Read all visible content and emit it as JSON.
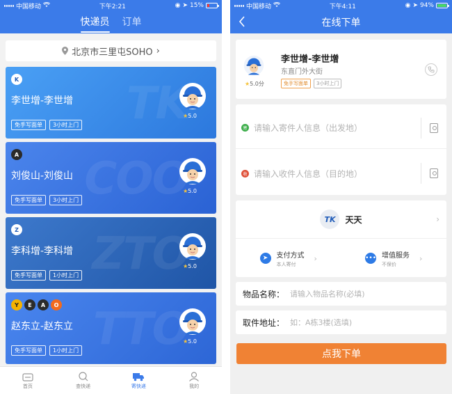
{
  "left": {
    "status": {
      "carrier": "中国移动",
      "time": "下午2:21",
      "battery": "15%"
    },
    "tabs": [
      {
        "label": "快递员"
      },
      {
        "label": "订单"
      }
    ],
    "location": "北京市三里屯SOHO",
    "couriers": [
      {
        "name": "李世增-李世增",
        "logos": [
          "K"
        ],
        "tags": [
          "免手写面单",
          "3小时上门"
        ],
        "rating": "5.0"
      },
      {
        "name": "刘俊山-刘俊山",
        "logos": [
          "A"
        ],
        "tags": [
          "免手写面单",
          "3小时上门"
        ],
        "rating": "5.0"
      },
      {
        "name": "李科增-李科增",
        "logos": [
          "Z"
        ],
        "tags": [
          "免手写面单",
          "1小时上门"
        ],
        "rating": "5.0"
      },
      {
        "name": "赵东立-赵东立",
        "logos": [
          "Y",
          "E",
          "A",
          "O"
        ],
        "tags": [
          "免手写面单",
          "1小时上门"
        ],
        "rating": "5.0"
      }
    ],
    "nav": [
      {
        "label": "首页"
      },
      {
        "label": "查快递"
      },
      {
        "label": "寄快递"
      },
      {
        "label": "我的"
      }
    ]
  },
  "right": {
    "status": {
      "carrier": "中国移动",
      "time": "下午4:11",
      "battery": "94%"
    },
    "title": "在线下单",
    "courier": {
      "name": "李世增-李世增",
      "address": "东直门外大街",
      "rating": "5.0分",
      "tags": [
        "免手写面单",
        "3小时上门"
      ]
    },
    "sender_placeholder": "请输入寄件人信息（出发地）",
    "receiver_placeholder": "请输入收件人信息（目的地）",
    "sender_dot": "寄",
    "receiver_dot": "收",
    "company": {
      "logo": "TK",
      "name": "天天"
    },
    "payment": {
      "title": "支付方式",
      "sub": "本人寄付"
    },
    "service": {
      "title": "增值服务",
      "sub": "不保价"
    },
    "item": {
      "label": "物品名称：",
      "placeholder": "请输入物品名称(必填)"
    },
    "pickup": {
      "label": "取件地址：",
      "placeholder": "如：A栋3楼(选填)"
    },
    "submit": "点我下单"
  },
  "colors": {
    "primary": "#3b7be9",
    "accent": "#f08234"
  }
}
